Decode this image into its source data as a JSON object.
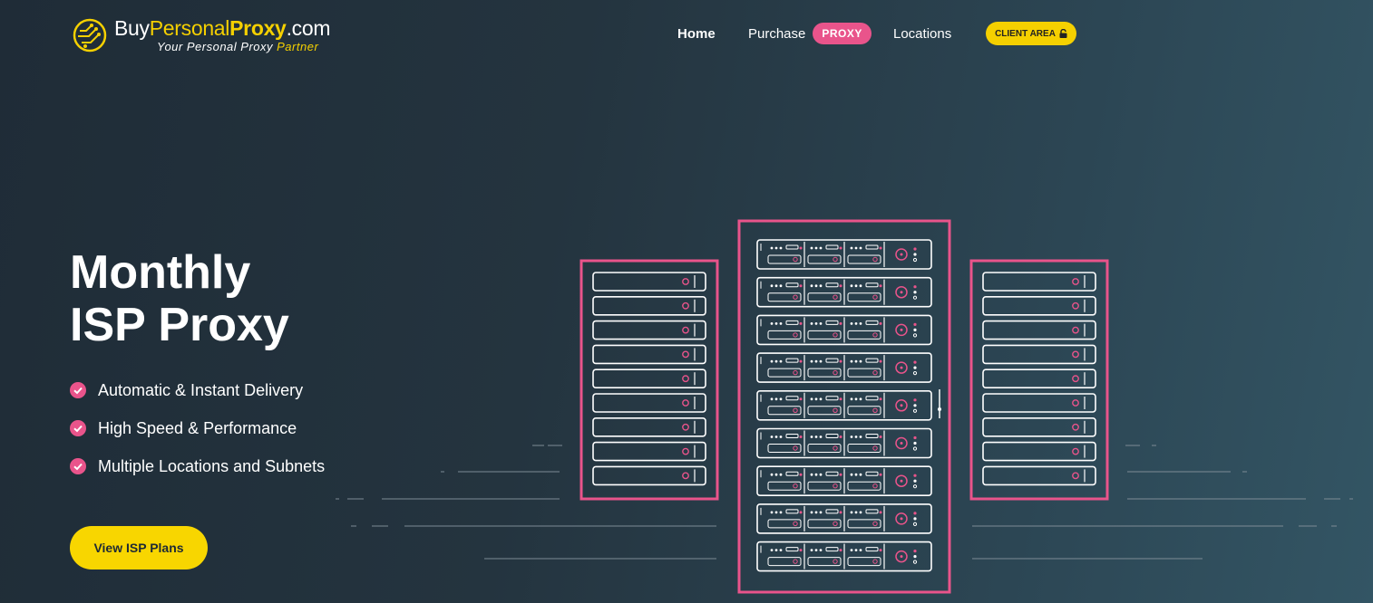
{
  "brand": {
    "name_part1": "Buy",
    "name_part2": "Personal",
    "name_part3": "Proxy",
    "name_part4": ".com",
    "tagline": "Your Personal Proxy",
    "tagline_accent": "Partner"
  },
  "nav": {
    "home": "Home",
    "purchase": "Purchase",
    "purchase_badge": "PROXY",
    "locations": "Locations",
    "client_area": "CLIENT AREA"
  },
  "hero": {
    "title_line1": "Monthly",
    "title_line2": "ISP Proxy",
    "features": [
      "Automatic & Instant Delivery",
      "High Speed & Performance",
      "Multiple Locations and Subnets"
    ],
    "cta": "View ISP Plans"
  },
  "colors": {
    "accent_yellow": "#f5d000",
    "accent_pink": "#e9548b",
    "background": "#24343f"
  },
  "icons": {
    "logo": "circuit-globe-icon",
    "lock": "lock-icon",
    "check": "check-circle-icon"
  }
}
